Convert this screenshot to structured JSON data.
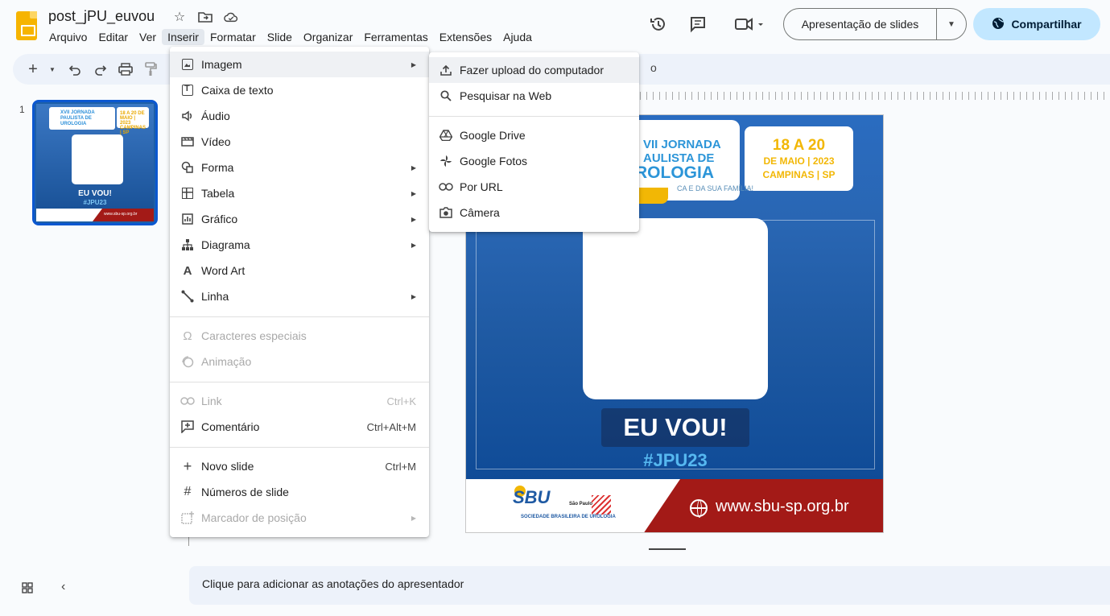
{
  "header": {
    "doc_title": "post_jPU_euvou",
    "menu": [
      "Arquivo",
      "Editar",
      "Ver",
      "Inserir",
      "Formatar",
      "Slide",
      "Organizar",
      "Ferramentas",
      "Extensões",
      "Ajuda"
    ],
    "slideshow_label": "Apresentação de slides",
    "share_label": "Compartilhar"
  },
  "toolbar": {
    "fragment": "o"
  },
  "filmstrip": {
    "slide_number": "1",
    "thumb_title": "XVII JORNADA PAULISTA DE UROLOGIA",
    "thumb_date": "18 A 20 DE MAIO | 2023 CAMPINAS | SP",
    "thumb_eu": "EU VOU!",
    "thumb_hashtag": "#JPU23",
    "thumb_url": "www.sbu-sp.org.br"
  },
  "slide": {
    "jornada": "VII JORNADA",
    "paulista": "AULISTA DE",
    "urologia": "ROLOGIA",
    "subtitle": "CA E DA SUA FAMÍLIA!",
    "date_line1": "18 A 20",
    "date_line2": "DE MAIO | 2023",
    "date_line3": "CAMPINAS | SP",
    "eu_vou": "EU VOU!",
    "hashtag": "#JPU23",
    "url": "www.sbu-sp.org.br",
    "logo_mark": "SBU",
    "logo_sp": "São Paulo",
    "logo_text": "SOCIEDADE BRASILEIRA DE UROLOGIA"
  },
  "notes": {
    "placeholder": "Clique para adicionar as anotações do apresentador"
  },
  "insert_menu": {
    "items": [
      {
        "label": "Imagem"
      },
      {
        "label": "Caixa de texto"
      },
      {
        "label": "Áudio"
      },
      {
        "label": "Vídeo"
      },
      {
        "label": "Forma"
      },
      {
        "label": "Tabela"
      },
      {
        "label": "Gráfico"
      },
      {
        "label": "Diagrama"
      },
      {
        "label": "Word Art"
      },
      {
        "label": "Linha"
      },
      {
        "label": "Caracteres especiais"
      },
      {
        "label": "Animação"
      },
      {
        "label": "Link",
        "shortcut": "Ctrl+K"
      },
      {
        "label": "Comentário",
        "shortcut": "Ctrl+Alt+M"
      },
      {
        "label": "Novo slide",
        "shortcut": "Ctrl+M"
      },
      {
        "label": "Números de slide"
      },
      {
        "label": "Marcador de posição"
      }
    ]
  },
  "image_submenu": {
    "items": [
      {
        "label": "Fazer upload do computador"
      },
      {
        "label": "Pesquisar na Web"
      },
      {
        "label": "Google Drive"
      },
      {
        "label": "Google Fotos"
      },
      {
        "label": "Por URL"
      },
      {
        "label": "Câmera"
      }
    ]
  }
}
